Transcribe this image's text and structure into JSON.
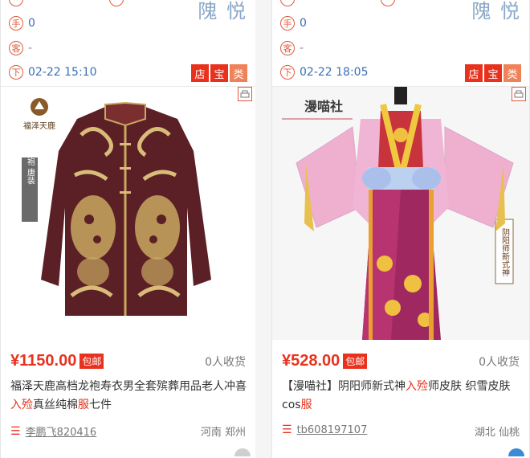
{
  "cards": [
    {
      "brand_watermark": "隗 悦",
      "hand_icon": "手",
      "hand_value": "0",
      "guest_icon": "客",
      "guest_value": "-",
      "down_icon": "下",
      "time": "02-22 15:10",
      "tags": [
        "店",
        "宝",
        "类"
      ],
      "price": "¥1150.00",
      "free_ship": "包邮",
      "sold": "0人收货",
      "title_parts": [
        "福泽天鹿高档龙袍寿衣男全套殡葬用品老人冲喜",
        "入殓",
        "真丝纯棉",
        "服",
        "七件"
      ],
      "seller": "李鹏飞820416",
      "location": "河南 郑州",
      "image_brand": "福泽天鹿",
      "image_side": "龙袍 唐装"
    },
    {
      "brand_watermark": "隗 悦",
      "hand_icon": "手",
      "hand_value": "0",
      "guest_icon": "客",
      "guest_value": "-",
      "down_icon": "下",
      "time": "02-22 18:05",
      "tags": [
        "店",
        "宝",
        "类"
      ],
      "price": "¥528.00",
      "free_ship": "包邮",
      "sold": "0人收货",
      "title_parts": [
        "【漫喵社】阴阳师新式神",
        "入殓",
        "师皮肤 织雪皮肤cos",
        "服",
        ""
      ],
      "seller": "tb608197107",
      "location": "湖北 仙桃",
      "image_brand": "漫喵社",
      "image_side": "阴阳师新式神"
    }
  ]
}
